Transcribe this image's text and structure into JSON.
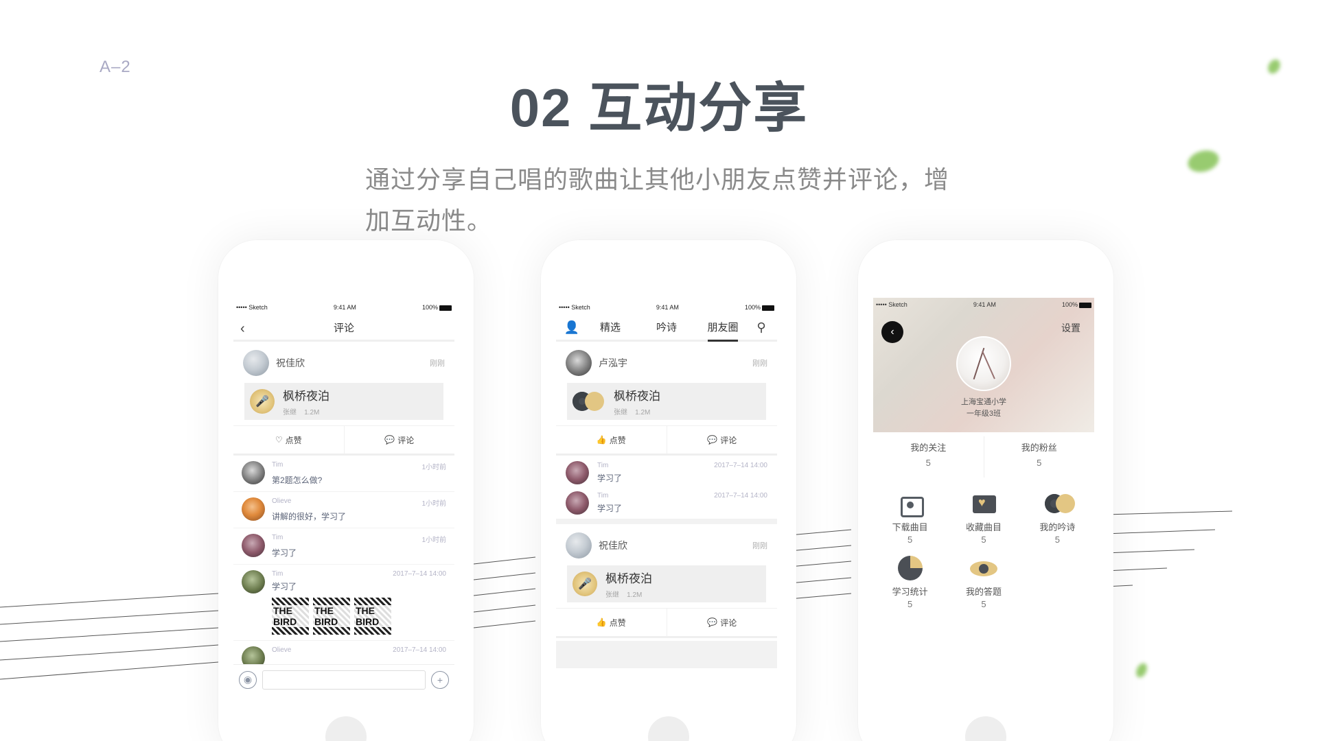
{
  "page": {
    "label": "A–2",
    "title": "02 互动分享",
    "subtitle": "通过分享自己唱的歌曲让其他小朋友点赞并评论，增加互动性。"
  },
  "statusbar": {
    "carrier": "••••• Sketch",
    "time": "9:41 AM",
    "battery": "100%"
  },
  "phone1": {
    "nav_title": "评论",
    "post": {
      "user": "祝佳欣",
      "time": "刚刚",
      "song_title": "枫桥夜泊",
      "song_author": "张继",
      "song_size": "1.2M"
    },
    "like_label": "点赞",
    "comment_label": "评论",
    "comments": [
      {
        "name": "Tim",
        "text": "第2题怎么做?",
        "time": "1小时前"
      },
      {
        "name": "Olieve",
        "text": "讲解的很好，学习了",
        "time": "1小时前"
      },
      {
        "name": "Tim",
        "text": "学习了",
        "time": "1小时前"
      },
      {
        "name": "Tim",
        "text": "学习了",
        "time": "2017–7–14 14:00"
      }
    ],
    "image_caption": "THE BIRD",
    "partial_comment": {
      "name": "Olieve",
      "time": "2017–7–14 14:00"
    }
  },
  "phone2": {
    "tabs": [
      "精选",
      "吟诗",
      "朋友圈"
    ],
    "active_tab": "朋友圈",
    "post1": {
      "user": "卢泓宇",
      "time": "刚刚",
      "song_title": "枫桥夜泊",
      "song_author": "张继",
      "song_size": "1.2M"
    },
    "comments": [
      {
        "name": "Tim",
        "text": "学习了",
        "time": "2017–7–14 14:00"
      },
      {
        "name": "Tim",
        "text": "学习了",
        "time": "2017–7–14 14:00"
      }
    ],
    "post2": {
      "user": "祝佳欣",
      "time": "刚刚",
      "song_title": "枫桥夜泊",
      "song_author": "张继",
      "song_size": "1.2M"
    },
    "like_label": "点赞",
    "comment_label": "评论"
  },
  "phone3": {
    "settings": "设置",
    "school_line1": "上海宝通小学",
    "school_line2": "一年级3班",
    "follow": {
      "label": "我的关注",
      "count": "5"
    },
    "fans": {
      "label": "我的粉丝",
      "count": "5"
    },
    "grid": [
      {
        "label": "下载曲目",
        "count": "5",
        "icon": "download-disc-icon"
      },
      {
        "label": "收藏曲目",
        "count": "5",
        "icon": "favorite-heart-icon"
      },
      {
        "label": "我的吟诗",
        "count": "5",
        "icon": "poem-disc-icon"
      },
      {
        "label": "学习统计",
        "count": "5",
        "icon": "pie-stats-icon"
      },
      {
        "label": "我的答题",
        "count": "5",
        "icon": "eye-answer-icon"
      }
    ]
  }
}
